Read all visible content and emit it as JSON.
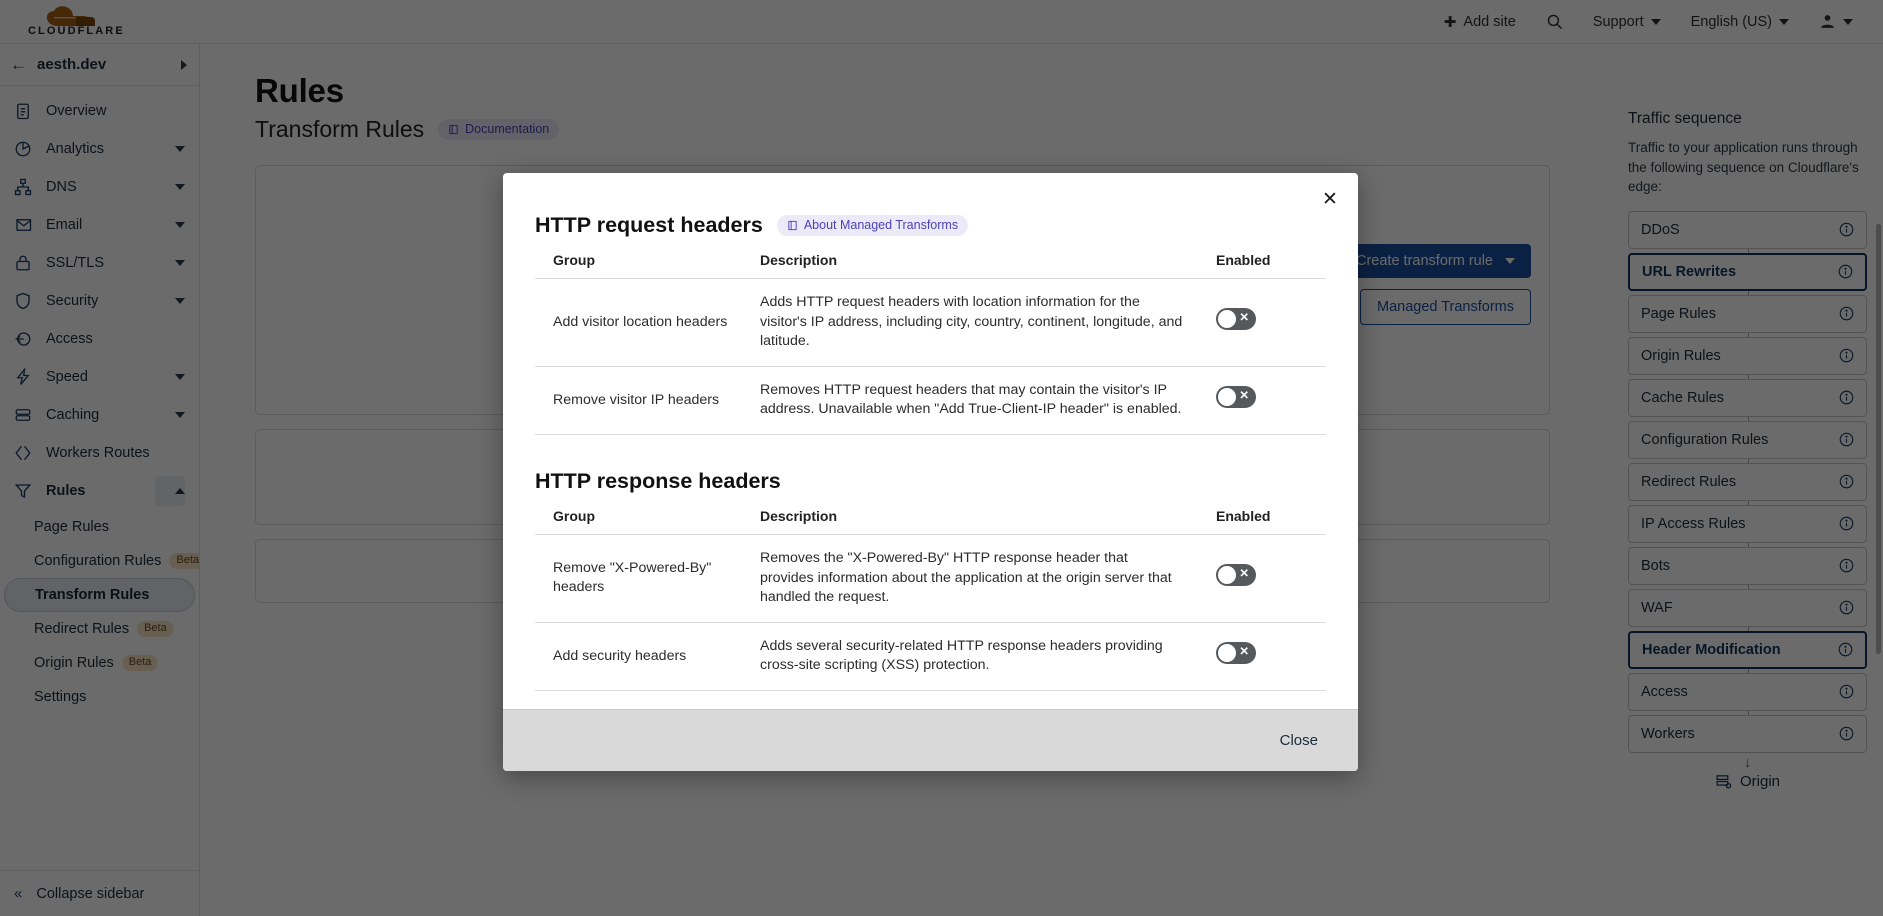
{
  "topbar": {
    "logo_text": "CLOUDFLARE",
    "add_site": "Add site",
    "support": "Support",
    "language": "English (US)"
  },
  "sidebar": {
    "zone": "aesth.dev",
    "items": [
      {
        "label": "Overview",
        "icon": "clipboard-icon",
        "expandable": false
      },
      {
        "label": "Analytics",
        "icon": "pie-chart-icon",
        "expandable": true
      },
      {
        "label": "DNS",
        "icon": "sitemap-icon",
        "expandable": true
      },
      {
        "label": "Email",
        "icon": "envelope-icon",
        "expandable": true
      },
      {
        "label": "SSL/TLS",
        "icon": "lock-icon",
        "expandable": true
      },
      {
        "label": "Security",
        "icon": "shield-icon",
        "expandable": true
      },
      {
        "label": "Access",
        "icon": "login-icon",
        "expandable": false
      },
      {
        "label": "Speed",
        "icon": "bolt-icon",
        "expandable": true
      },
      {
        "label": "Caching",
        "icon": "database-icon",
        "expandable": true
      },
      {
        "label": "Workers Routes",
        "icon": "workers-icon",
        "expandable": false
      },
      {
        "label": "Rules",
        "icon": "funnel-icon",
        "expandable": true,
        "expanded": true
      }
    ],
    "rules_subitems": [
      {
        "label": "Page Rules",
        "badge": "",
        "active": false
      },
      {
        "label": "Configuration Rules",
        "badge": "Beta",
        "active": false
      },
      {
        "label": "Transform Rules",
        "badge": "",
        "active": true
      },
      {
        "label": "Redirect Rules",
        "badge": "Beta",
        "active": false
      },
      {
        "label": "Origin Rules",
        "badge": "Beta",
        "active": false
      },
      {
        "label": "Settings",
        "badge": "",
        "active": false
      }
    ],
    "collapse_label": "Collapse sidebar"
  },
  "main": {
    "title": "Rules",
    "subtitle": "Transform Rules",
    "documentation_pill": "Documentation",
    "create_rule_button": "Create transform rule",
    "managed_transforms_button": "Managed Transforms"
  },
  "rail": {
    "title": "Traffic sequence",
    "description": "Traffic to your application runs through the following sequence on Cloudflare's edge:",
    "nodes": [
      {
        "label": "DDoS",
        "highlighted": false
      },
      {
        "label": "URL Rewrites",
        "highlighted": true
      },
      {
        "label": "Page Rules",
        "highlighted": false
      },
      {
        "label": "Origin Rules",
        "highlighted": false
      },
      {
        "label": "Cache Rules",
        "highlighted": false
      },
      {
        "label": "Configuration Rules",
        "highlighted": false
      },
      {
        "label": "Redirect Rules",
        "highlighted": false
      },
      {
        "label": "IP Access Rules",
        "highlighted": false
      },
      {
        "label": "Bots",
        "highlighted": false
      },
      {
        "label": "WAF",
        "highlighted": false
      },
      {
        "label": "Header Modification",
        "highlighted": true
      },
      {
        "label": "Access",
        "highlighted": false
      },
      {
        "label": "Workers",
        "highlighted": false
      }
    ],
    "origin_label": "Origin"
  },
  "modal": {
    "request_section": {
      "title": "HTTP request headers",
      "about_link": "About Managed Transforms",
      "columns": {
        "group": "Group",
        "description": "Description",
        "enabled": "Enabled"
      },
      "rows": [
        {
          "group": "Add visitor location headers",
          "description": "Adds HTTP request headers with location information for the visitor's IP address, including city, country, continent, longitude, and latitude.",
          "enabled": false
        },
        {
          "group": "Remove visitor IP headers",
          "description": "Removes HTTP request headers that may contain the visitor's IP address. Unavailable when \"Add True-Client-IP header\" is enabled.",
          "enabled": false
        }
      ]
    },
    "response_section": {
      "title": "HTTP response headers",
      "columns": {
        "group": "Group",
        "description": "Description",
        "enabled": "Enabled"
      },
      "rows": [
        {
          "group": "Remove \"X-Powered-By\" headers",
          "description": "Removes the \"X-Powered-By\" HTTP response header that provides information about the application at the origin server that handled the request.",
          "enabled": false
        },
        {
          "group": "Add security headers",
          "description": "Adds several security-related HTTP response headers providing cross-site scripting (XSS) protection.",
          "enabled": false
        }
      ]
    },
    "close_button": "Close",
    "toggle_off_mark": "✕"
  },
  "colors": {
    "brand_orange": "#f6821f",
    "accent_blue": "#1c4fa1",
    "nav_navy": "#1c3d66",
    "doc_pill_bg": "#eceaf8",
    "doc_pill_text": "#4c42b8",
    "beta_bg": "#f5e3c4",
    "toggle_off": "#55595c",
    "footer_bg": "#d9d9d9"
  }
}
